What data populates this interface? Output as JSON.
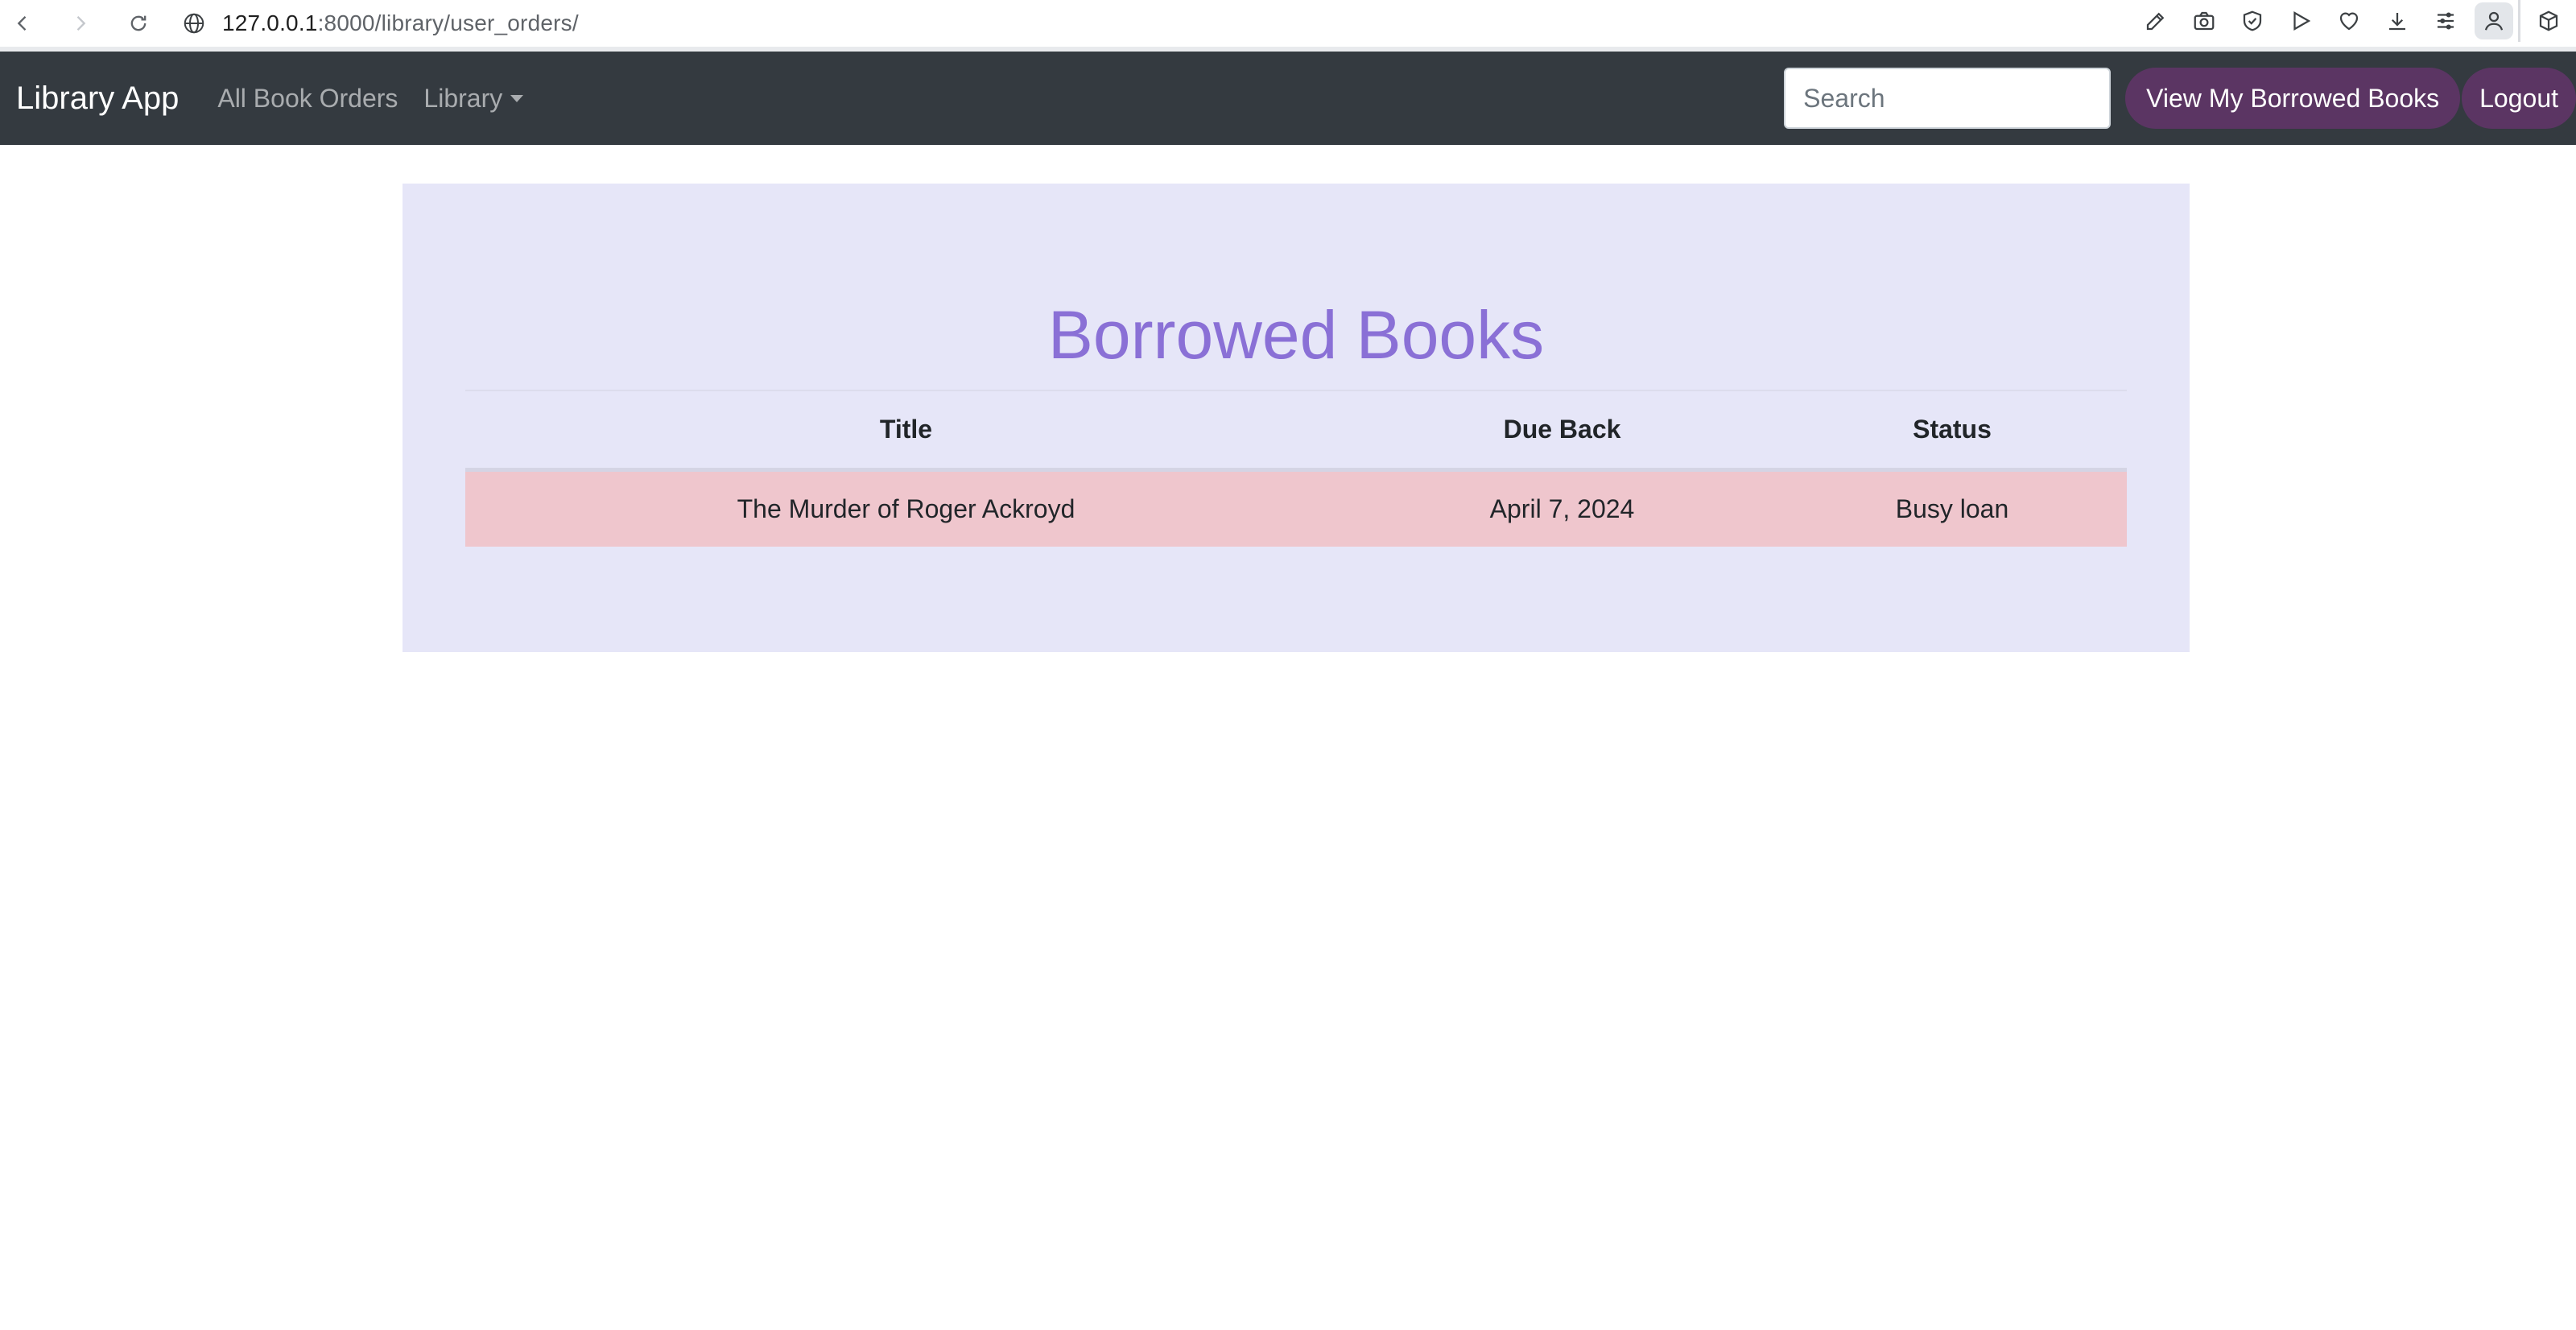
{
  "browser": {
    "url_host": "127.0.0.1",
    "url_rest": ":8000/library/user_orders/",
    "icons": [
      "back-icon",
      "forward-icon",
      "reload-icon",
      "globe-icon",
      "edit-icon",
      "camera-icon",
      "shield-icon",
      "play-icon",
      "heart-icon",
      "download-icon",
      "menu-icon",
      "profile-icon",
      "extension-icon"
    ]
  },
  "navbar": {
    "brand": "Library App",
    "links": {
      "all_orders": "All Book Orders",
      "library": "Library"
    },
    "search": {
      "placeholder": "Search",
      "value": ""
    },
    "borrowed_button": "View My Borrowed Books",
    "logout_button": "Logout",
    "background_color": "#343a40",
    "button_color": "#5b3563"
  },
  "main": {
    "title": "Borrowed Books",
    "title_color": "#8a70d6",
    "panel_color": "#e6e6f8",
    "table": {
      "headers": {
        "title": "Title",
        "due_back": "Due Back",
        "status": "Status"
      },
      "rows": [
        {
          "title": "The Murder of Roger Ackroyd",
          "due_back": "April 7, 2024",
          "status": "Busy loan",
          "row_color": "#efc6cd"
        }
      ]
    }
  }
}
